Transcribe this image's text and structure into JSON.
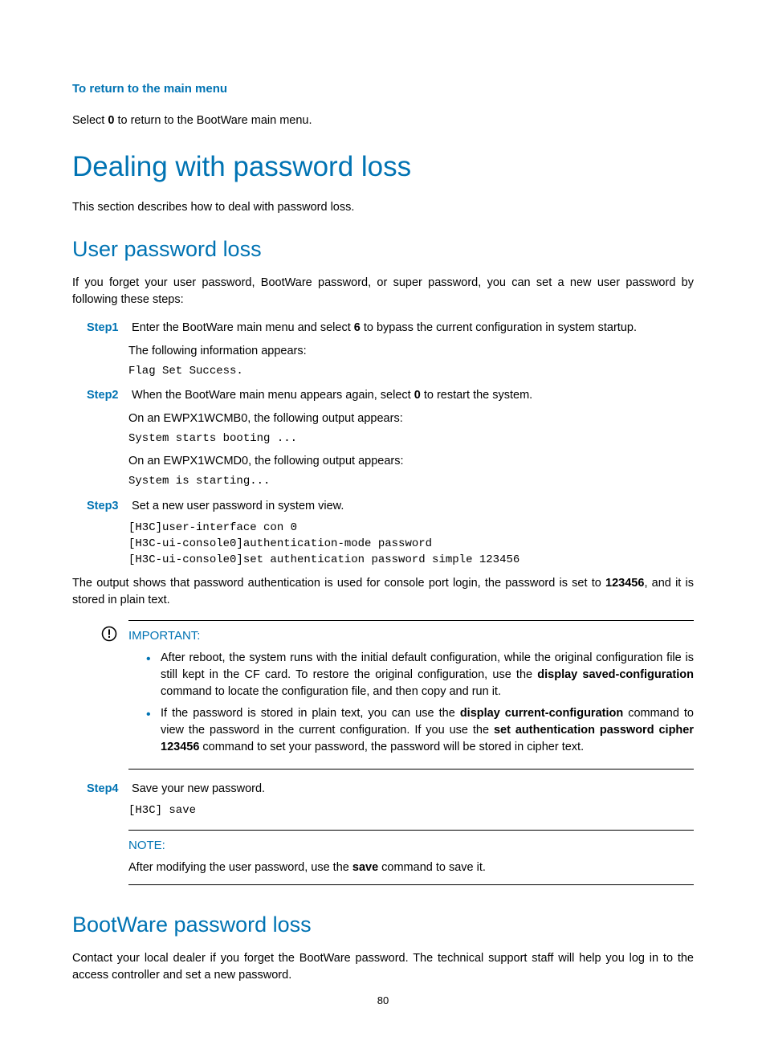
{
  "section_return": {
    "heading": "To return to the main menu",
    "body_pre": "Select ",
    "body_bold": "0",
    "body_post": " to return to the BootWare main menu."
  },
  "h1": "Dealing with password loss",
  "h1_sub": "This section describes how to deal with password loss.",
  "h2_user": "User password loss",
  "user_intro": "If you forget your user password, BootWare password, or super password, you can set a new user password by following these steps:",
  "steps": {
    "s1": {
      "label": "Step1",
      "text_pre": "Enter the BootWare main menu and select ",
      "text_bold": "6",
      "text_post": " to bypass the current configuration in system startup.",
      "sub1": "The following information appears:",
      "code1": "Flag Set Success."
    },
    "s2": {
      "label": "Step2",
      "text_pre": "When the BootWare main menu appears again, select ",
      "text_bold": "0",
      "text_post": " to restart the system.",
      "sub1": "On an EWPX1WCMB0, the following output appears:",
      "code1": "System starts booting ...",
      "sub2": "On an EWPX1WCMD0, the following output appears:",
      "code2": "System is starting..."
    },
    "s3": {
      "label": "Step3",
      "text": "Set a new user password in system view.",
      "code": "[H3C]user-interface con 0\n[H3C-ui-console0]authentication-mode password\n[H3C-ui-console0]set authentication password simple 123456",
      "out_pre": "The output shows that password authentication is used for console port login, the password is set to ",
      "out_bold": "123456",
      "out_post": ", and it is stored in plain text."
    },
    "s4": {
      "label": "Step4",
      "text": "Save your new password.",
      "code": "[H3C] save"
    }
  },
  "important": {
    "label": "IMPORTANT:",
    "b1_pre": "After reboot, the system runs with the initial default configuration, while the original configuration file is still kept in the CF card. To restore the original configuration, use the ",
    "b1_bold": "display saved-configuration",
    "b1_post": " command to locate the configuration file, and then copy and run it.",
    "b2_pre": "If the password is stored in plain text, you can use the ",
    "b2_bold1": "display current-configuration",
    "b2_mid": " command to view the password in the current configuration. If you use the ",
    "b2_bold2": "set authentication password cipher 123456",
    "b2_post": " command to set your password, the password will be stored in cipher text."
  },
  "note": {
    "label": "NOTE:",
    "body_pre": "After modifying the user password, use the ",
    "body_bold": "save",
    "body_post": " command to save it."
  },
  "h2_boot": "BootWare password loss",
  "boot_body": "Contact your local dealer if you forget the BootWare password. The technical support staff will help you log in to the access controller and set a new password.",
  "page_number": "80"
}
